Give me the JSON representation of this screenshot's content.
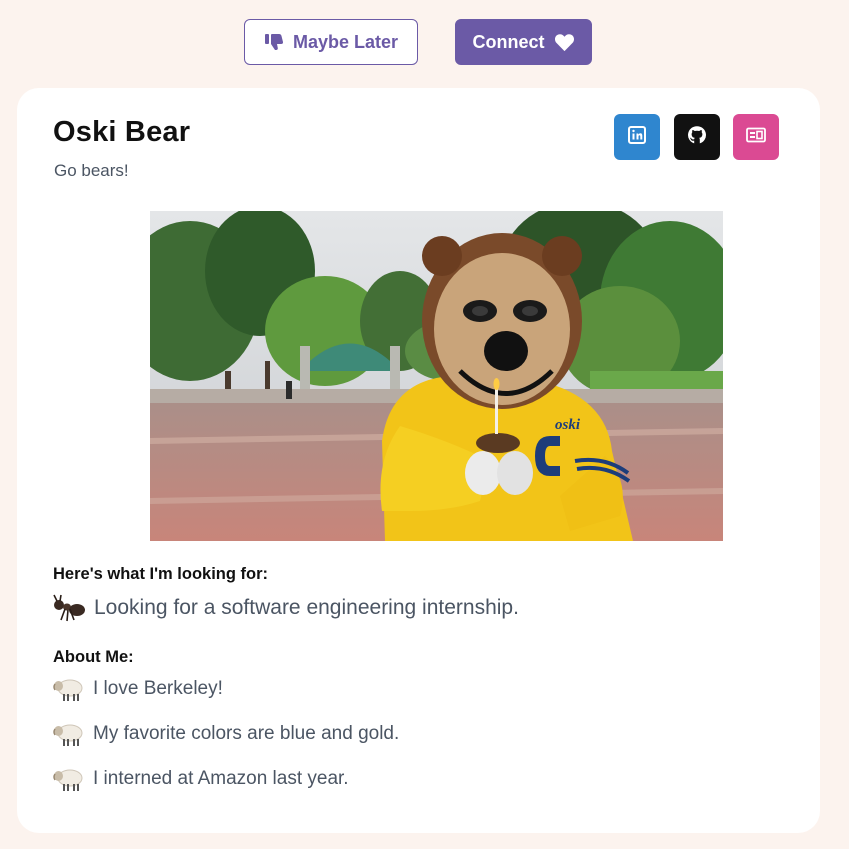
{
  "actions": {
    "later_label": "Maybe Later",
    "later_icon": "thumbs-down-icon",
    "connect_label": "Connect",
    "connect_icon": "heart-icon",
    "accent_color": "#6b5aa6"
  },
  "profile": {
    "name": "Oski Bear",
    "tagline": "Go bears!",
    "photo": "oski-bear-mascot-photo",
    "links": [
      {
        "icon": "linkedin-icon",
        "color": "#2f86cf"
      },
      {
        "icon": "github-icon",
        "color": "#111111"
      },
      {
        "icon": "resume-icon",
        "color": "#db4a93"
      }
    ]
  },
  "looking_for": {
    "heading": "Here's what I'm looking for:",
    "icon": "ant-icon",
    "text": "Looking for a software engineering internship."
  },
  "about": {
    "heading": "About Me:",
    "items": [
      {
        "icon": "sheep-icon",
        "text": "I love Berkeley!"
      },
      {
        "icon": "sheep-icon",
        "text": "My favorite colors are blue and gold."
      },
      {
        "icon": "sheep-icon",
        "text": "I interned at Amazon last year."
      }
    ]
  }
}
